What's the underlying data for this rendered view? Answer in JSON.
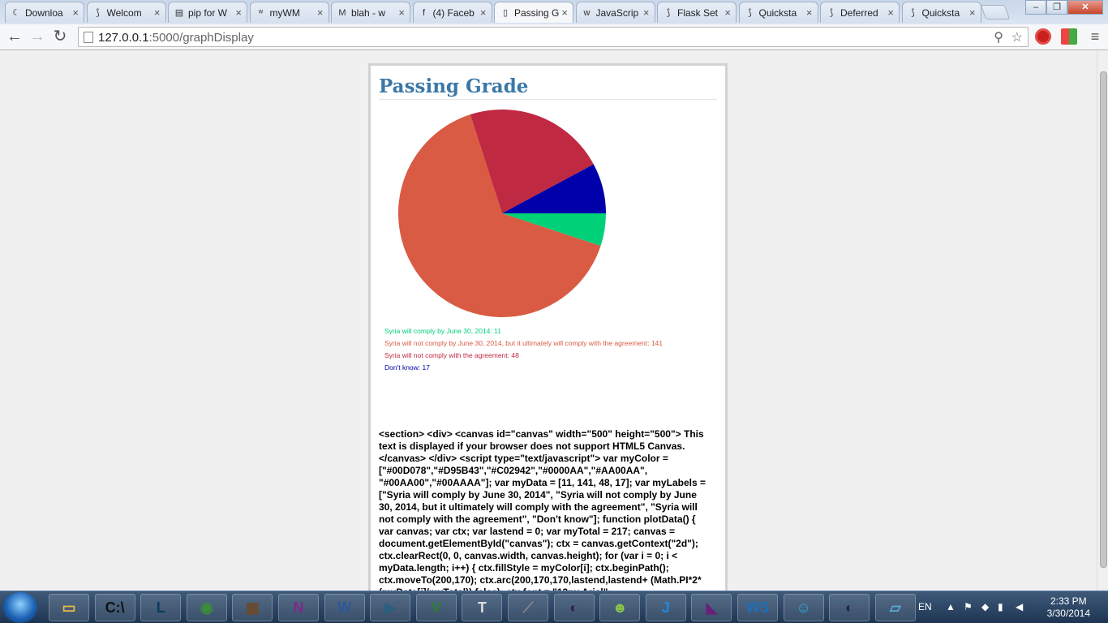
{
  "tabs": [
    {
      "label": "Downloa",
      "icon": "curl-icon"
    },
    {
      "label": "Welcom",
      "icon": "flask-icon"
    },
    {
      "label": "pip for W",
      "icon": "doc-icon"
    },
    {
      "label": "myWM",
      "icon": "wm-icon"
    },
    {
      "label": "blah - w",
      "icon": "gmail-icon"
    },
    {
      "label": "(4) Faceb",
      "icon": "facebook-icon"
    },
    {
      "label": "Passing G",
      "icon": "page-icon",
      "active": true
    },
    {
      "label": "JavaScrip",
      "icon": "w3-icon"
    },
    {
      "label": "Flask Set",
      "icon": "flask-icon"
    },
    {
      "label": "Quicksta",
      "icon": "flask-icon"
    },
    {
      "label": "Deferred",
      "icon": "flask-icon"
    },
    {
      "label": "Quicksta",
      "icon": "flask-icon"
    }
  ],
  "address": {
    "host": "127.0.0.1",
    "path": ":5000/graphDisplay"
  },
  "page": {
    "title": "Passing Grade",
    "source_text": "<section> <div> <canvas id=\"canvas\" width=\"500\" height=\"500\"> This text is displayed if your browser does not support HTML5 Canvas. </canvas> </div> <script type=\"text/javascript\"> var myColor = [\"#00D078\",\"#D95B43\",\"#C02942\",\"#0000AA\",\"#AA00AA\", \"#00AA00\",\"#00AAAA\"]; var myData = [11, 141, 48, 17]; var myLabels = [\"Syria will comply by June 30, 2014\", \"Syria will not comply by June 30, 2014, but it ultimately will comply with the agreement\", \"Syria will not comply with the agreement\", \"Don't know\"]; function plotData() { var canvas; var ctx; var lastend = 0; var myTotal = 217; canvas = document.getElementById(\"canvas\"); ctx = canvas.getContext(\"2d\"); ctx.clearRect(0, 0, canvas.width, canvas.height); for (var i = 0; i < myData.length; i++) { ctx.fillStyle = myColor[i]; ctx.beginPath(); ctx.moveTo(200,170); ctx.arc(200,170,170,lastend,lastend+ (Math.PI*2* (myData[i]/myTotal)),false); ctx.font = \"12px Arial\";"
  },
  "chart_data": {
    "type": "pie",
    "categories": [
      "Syria will comply by June 30, 2014",
      "Syria will not comply by June 30, 2014, but it ultimately will comply with the agreement",
      "Syria will not comply with the agreement",
      "Don't know"
    ],
    "values": [
      11,
      141,
      48,
      17
    ],
    "colors": [
      "#00D078",
      "#D95B43",
      "#C02942",
      "#0000AA"
    ],
    "legend": [
      "Syria will comply by June 30, 2014: 11",
      "Syria will not comply by June 30, 2014, but it ultimately will comply with the agreement: 141",
      "Syria will not comply with the agreement: 48",
      "Don't know: 17"
    ],
    "legend_placement": "bottom"
  },
  "taskbar": {
    "apps": [
      "explorer",
      "cmd",
      "league-of-legends",
      "chrome",
      "minecraft",
      "onenote",
      "word",
      "mysql-workbench",
      "vim",
      "texnic",
      "feather",
      "eclipse",
      "android-sdk",
      "jetbrains",
      "visual-studio",
      "webstorm",
      "app",
      "eclipse-2",
      "notepad"
    ],
    "lang": "EN",
    "time": "2:33 PM",
    "date": "3/30/2014"
  }
}
